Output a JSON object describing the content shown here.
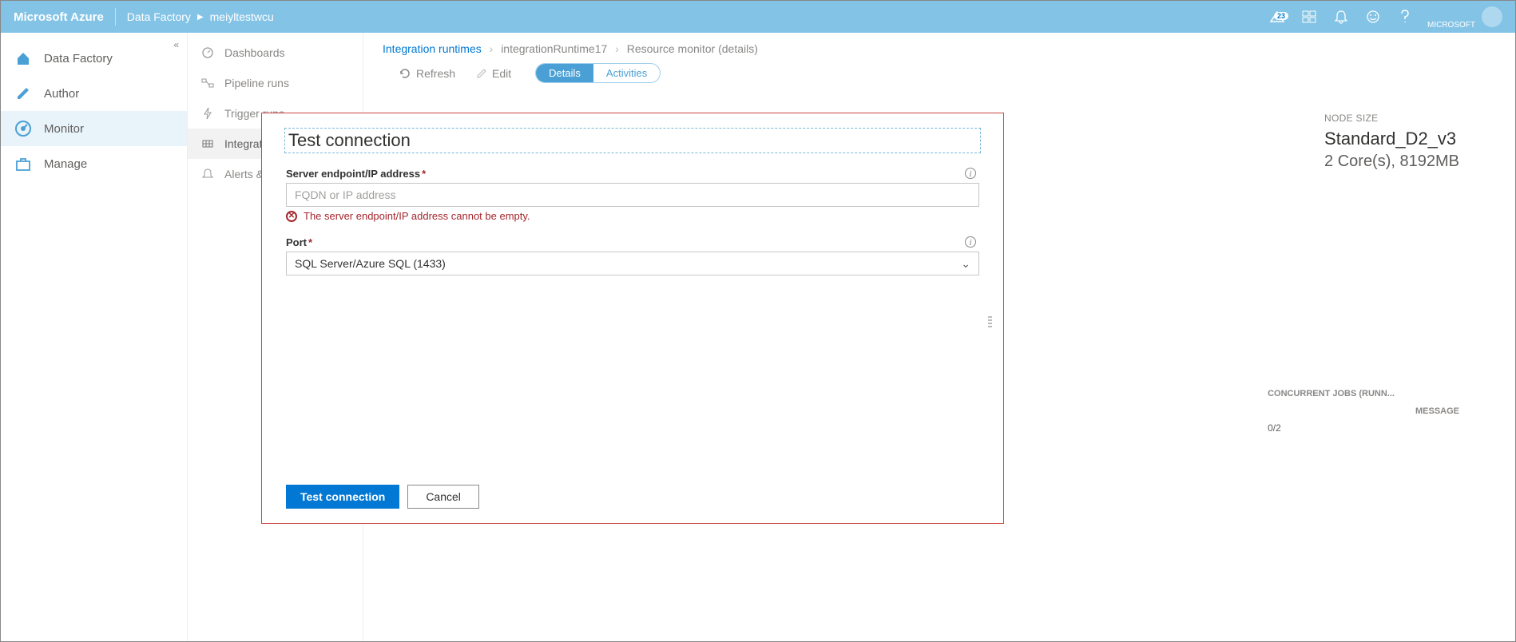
{
  "header": {
    "brand": "Microsoft Azure",
    "crumb1": "Data Factory",
    "crumb2": "meiyltestwcu",
    "badge": "23",
    "tenant": "MICROSOFT"
  },
  "nav1": {
    "items": [
      {
        "label": "Data Factory"
      },
      {
        "label": "Author"
      },
      {
        "label": "Monitor"
      },
      {
        "label": "Manage"
      }
    ]
  },
  "nav2": {
    "items": [
      {
        "label": "Dashboards"
      },
      {
        "label": "Pipeline runs"
      },
      {
        "label": "Trigger runs"
      },
      {
        "label": "Integrati..."
      },
      {
        "label": "Alerts &..."
      }
    ]
  },
  "breadcrumb": {
    "a": "Integration runtimes",
    "b": "integrationRuntime17",
    "c": "Resource monitor (details)"
  },
  "toolbar": {
    "refresh": "Refresh",
    "edit": "Edit",
    "details": "Details",
    "activities": "Activities"
  },
  "card": {
    "label": "NODE SIZE",
    "val1": "Standard_D2_v3",
    "val2": "2 Core(s), 8192MB"
  },
  "status": {
    "h1": "CONCURRENT JOBS (RUNN...",
    "h2": "MESSAGE",
    "v1": "0/2"
  },
  "modal": {
    "title": "Test connection",
    "server_label": "Server endpoint/IP address",
    "server_placeholder": "FQDN or IP address",
    "server_error": "The server endpoint/IP address cannot be empty.",
    "port_label": "Port",
    "port_value": "SQL Server/Azure SQL (1433)",
    "btn_test": "Test connection",
    "btn_cancel": "Cancel"
  }
}
